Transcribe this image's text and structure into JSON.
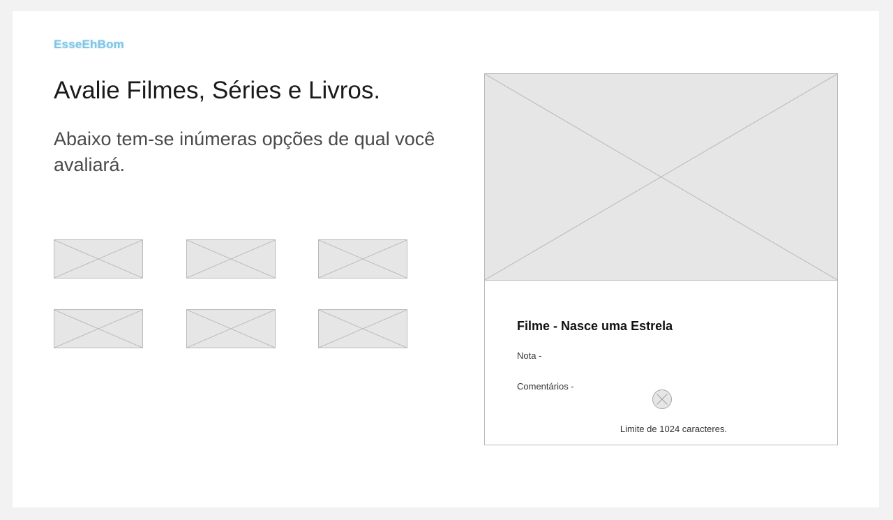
{
  "brand": {
    "name": "EsseEhBom",
    "color": "#7fc4e6"
  },
  "hero": {
    "title": "Avalie Filmes, Séries e Livros.",
    "subtitle": "Abaixo tem-se inúmeras opções de qual você avaliará."
  },
  "grid": {
    "items": [
      {
        "name": "image-placeholder-icon"
      },
      {
        "name": "image-placeholder-icon"
      },
      {
        "name": "image-placeholder-icon"
      },
      {
        "name": "image-placeholder-icon"
      },
      {
        "name": "image-placeholder-icon"
      },
      {
        "name": "image-placeholder-icon"
      }
    ]
  },
  "detail": {
    "image_icon": "image-placeholder-icon",
    "title": "Filme - Nasce uma Estrela",
    "rating_label": "Nota -",
    "comments_label": "Comentários -",
    "comments_icon": "placeholder-circle-icon",
    "limit_text": "Limite de 1024 caracteres."
  }
}
